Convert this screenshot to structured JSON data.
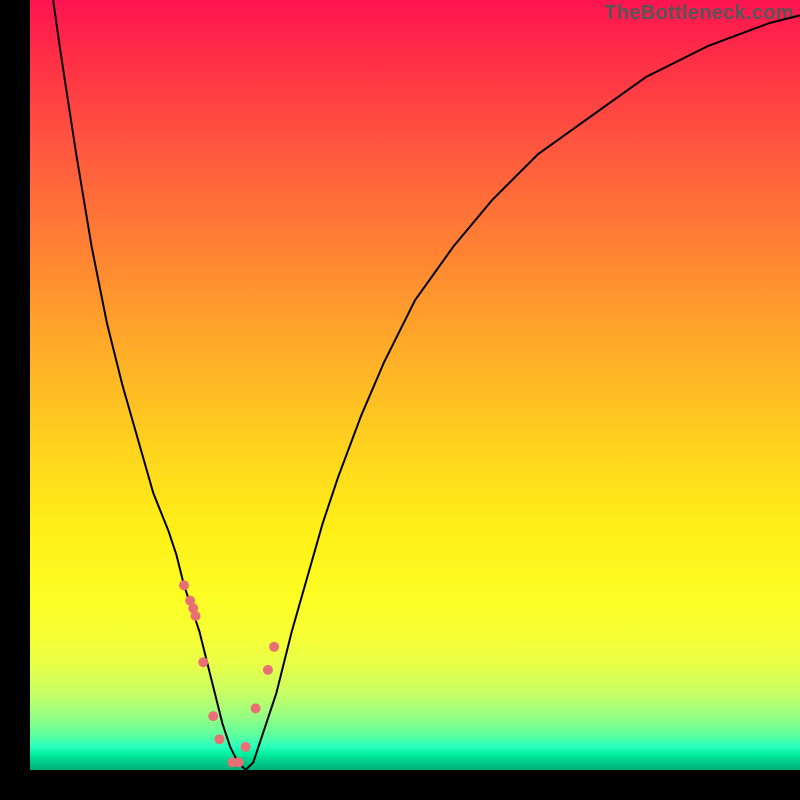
{
  "watermark": "TheBottleneck.com",
  "chart_data": {
    "type": "line",
    "title": "",
    "xlabel": "",
    "ylabel": "",
    "xlim": [
      0,
      100
    ],
    "ylim": [
      0,
      100
    ],
    "grid": false,
    "background": "rainbow-gradient-red-to-green",
    "series": [
      {
        "name": "curve",
        "x": [
          3,
          4,
          6,
          8,
          10,
          12,
          14,
          16,
          18,
          19,
          20,
          21,
          22,
          23,
          24,
          25,
          26,
          27,
          28,
          29,
          30,
          32,
          34,
          36,
          38,
          40,
          43,
          46,
          50,
          55,
          60,
          66,
          73,
          80,
          88,
          96,
          100
        ],
        "y": [
          100,
          93,
          80,
          68,
          58,
          50,
          43,
          36,
          31,
          28,
          24,
          21,
          18,
          14,
          10,
          6,
          3,
          1,
          0,
          1,
          4,
          10,
          18,
          25,
          32,
          38,
          46,
          53,
          61,
          68,
          74,
          80,
          85,
          90,
          94,
          97,
          98
        ]
      },
      {
        "name": "highlight-points",
        "x": [
          20.0,
          20.8,
          21.2,
          21.5,
          22.5,
          23.8,
          24.6,
          26.3,
          27.1,
          28.0,
          29.3,
          30.9,
          31.7
        ],
        "y": [
          24,
          22,
          21,
          20,
          14,
          7,
          4,
          1,
          1,
          3,
          8,
          13,
          16
        ]
      }
    ],
    "notch": {
      "x": 25.5,
      "y_percent": 0
    }
  }
}
